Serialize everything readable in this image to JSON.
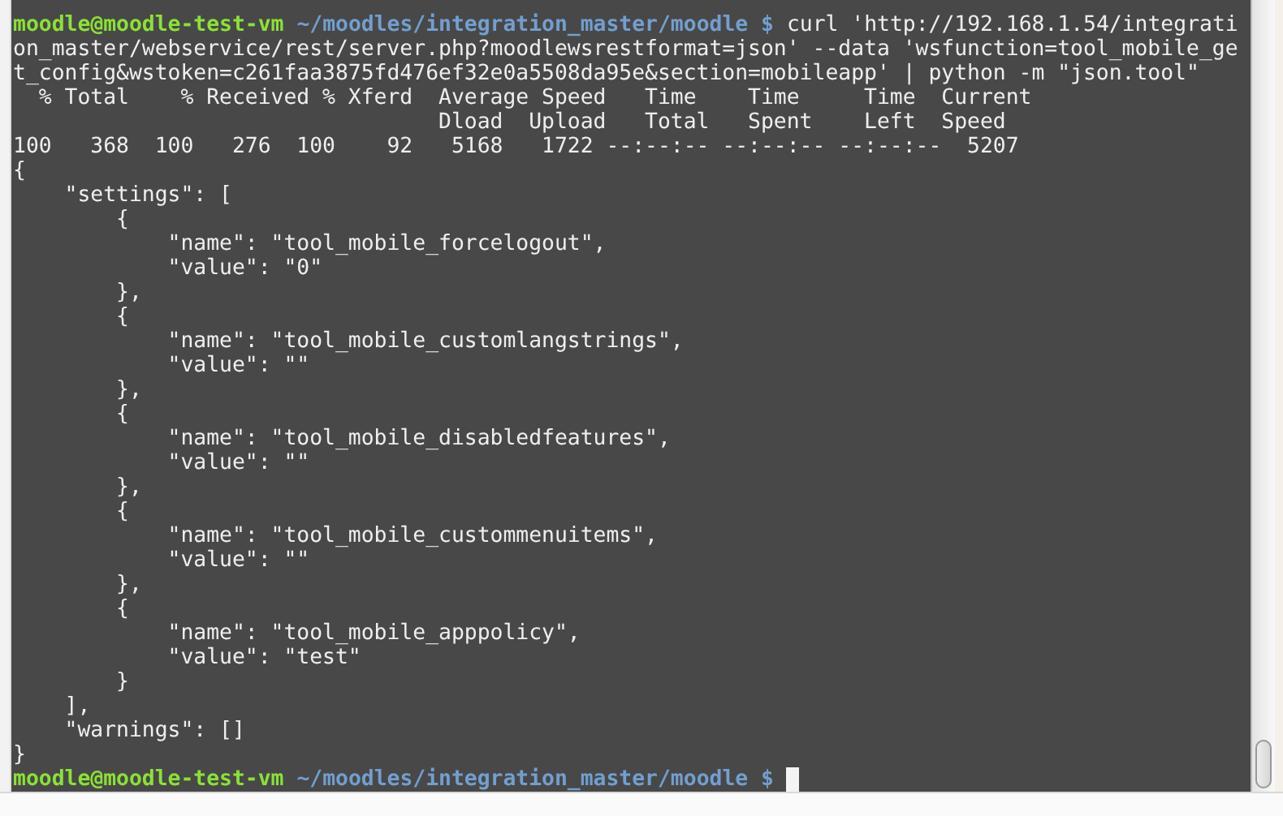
{
  "terminal": {
    "lines": [
      {
        "kind": "prompt",
        "user": "moodle@moodle-test-vm",
        "path": "~/moodles/integration_master/moodle",
        "symbol": "$",
        "command": "curl 'http://192.168.1.54/integrati"
      },
      {
        "kind": "output",
        "text": "on_master/webservice/rest/server.php?moodlewsrestformat=json' --data 'wsfunction=tool_mobile_ge"
      },
      {
        "kind": "output",
        "text": "t_config&wstoken=c261faa3875fd476ef32e0a5508da95e&section=mobileapp' | python -m \"json.tool\""
      },
      {
        "kind": "output",
        "text": "  % Total    % Received % Xferd  Average Speed   Time    Time     Time  Current"
      },
      {
        "kind": "output",
        "text": "                                 Dload  Upload   Total   Spent    Left  Speed"
      },
      {
        "kind": "output",
        "text": "100   368  100   276  100    92   5168   1722 --:--:-- --:--:-- --:--:--  5207"
      },
      {
        "kind": "output",
        "text": "{"
      },
      {
        "kind": "output",
        "text": "    \"settings\": ["
      },
      {
        "kind": "output",
        "text": "        {"
      },
      {
        "kind": "output",
        "text": "            \"name\": \"tool_mobile_forcelogout\","
      },
      {
        "kind": "output",
        "text": "            \"value\": \"0\""
      },
      {
        "kind": "output",
        "text": "        },"
      },
      {
        "kind": "output",
        "text": "        {"
      },
      {
        "kind": "output",
        "text": "            \"name\": \"tool_mobile_customlangstrings\","
      },
      {
        "kind": "output",
        "text": "            \"value\": \"\""
      },
      {
        "kind": "output",
        "text": "        },"
      },
      {
        "kind": "output",
        "text": "        {"
      },
      {
        "kind": "output",
        "text": "            \"name\": \"tool_mobile_disabledfeatures\","
      },
      {
        "kind": "output",
        "text": "            \"value\": \"\""
      },
      {
        "kind": "output",
        "text": "        },"
      },
      {
        "kind": "output",
        "text": "        {"
      },
      {
        "kind": "output",
        "text": "            \"name\": \"tool_mobile_custommenuitems\","
      },
      {
        "kind": "output",
        "text": "            \"value\": \"\""
      },
      {
        "kind": "output",
        "text": "        },"
      },
      {
        "kind": "output",
        "text": "        {"
      },
      {
        "kind": "output",
        "text": "            \"name\": \"tool_mobile_apppolicy\","
      },
      {
        "kind": "output",
        "text": "            \"value\": \"test\""
      },
      {
        "kind": "output",
        "text": "        }"
      },
      {
        "kind": "output",
        "text": "    ],"
      },
      {
        "kind": "output",
        "text": "    \"warnings\": []"
      },
      {
        "kind": "output",
        "text": "}"
      },
      {
        "kind": "prompt",
        "user": "moodle@moodle-test-vm",
        "path": "~/moodles/integration_master/moodle",
        "symbol": "$",
        "cursor": true
      }
    ]
  }
}
